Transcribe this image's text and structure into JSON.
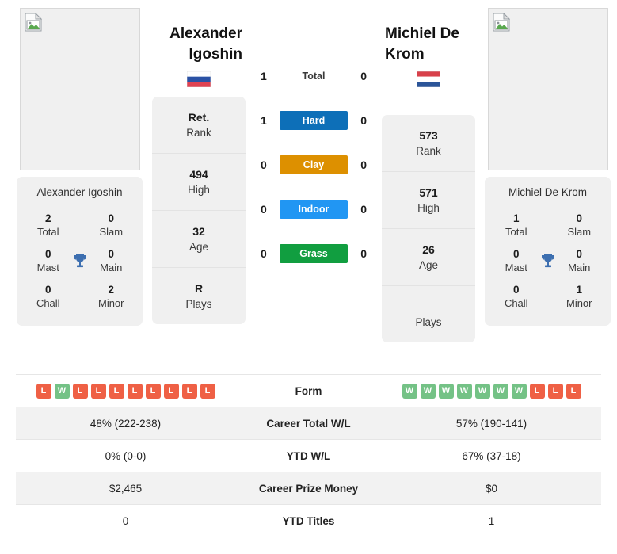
{
  "players": {
    "left": {
      "name": "Alexander Igoshin",
      "name_line1": "Alexander",
      "name_line2": "Igoshin",
      "flag": "russia-flag",
      "photo": "broken-image-icon",
      "info": [
        {
          "value": "Ret.",
          "label": "Rank"
        },
        {
          "value": "494",
          "label": "High"
        },
        {
          "value": "32",
          "label": "Age"
        },
        {
          "value": "R",
          "label": "Plays"
        }
      ],
      "titles": [
        {
          "value": "2",
          "label": "Total"
        },
        {
          "value": "0",
          "label": "Slam"
        },
        {
          "value": "0",
          "label": "Mast"
        },
        {
          "value": "0",
          "label": "Main"
        },
        {
          "value": "0",
          "label": "Chall"
        },
        {
          "value": "2",
          "label": "Minor"
        }
      ],
      "form": [
        "L",
        "W",
        "L",
        "L",
        "L",
        "L",
        "L",
        "L",
        "L",
        "L"
      ]
    },
    "right": {
      "name": "Michiel De Krom",
      "name_line1": "Michiel De",
      "name_line2": "Krom",
      "flag": "netherlands-flag",
      "photo": "broken-image-icon",
      "info": [
        {
          "value": "573",
          "label": "Rank"
        },
        {
          "value": "571",
          "label": "High"
        },
        {
          "value": "26",
          "label": "Age"
        },
        {
          "value": "",
          "label": "Plays"
        }
      ],
      "titles": [
        {
          "value": "1",
          "label": "Total"
        },
        {
          "value": "0",
          "label": "Slam"
        },
        {
          "value": "0",
          "label": "Mast"
        },
        {
          "value": "0",
          "label": "Main"
        },
        {
          "value": "0",
          "label": "Chall"
        },
        {
          "value": "1",
          "label": "Minor"
        }
      ],
      "form": [
        "W",
        "W",
        "W",
        "W",
        "W",
        "W",
        "W",
        "L",
        "L",
        "L"
      ]
    }
  },
  "head_to_head": [
    {
      "surface": "Total",
      "left": "1",
      "right": "0",
      "color": "none",
      "style": "plain"
    },
    {
      "surface": "Hard",
      "left": "1",
      "right": "0",
      "color": "#0D6FB8",
      "style": "badge"
    },
    {
      "surface": "Clay",
      "left": "0",
      "right": "0",
      "color": "#DD9000",
      "style": "badge"
    },
    {
      "surface": "Indoor",
      "left": "0",
      "right": "0",
      "color": "#2196F3",
      "style": "badge"
    },
    {
      "surface": "Grass",
      "left": "0",
      "right": "0",
      "color": "#119E40",
      "style": "badge"
    }
  ],
  "comparison_rows": [
    {
      "label": "Form",
      "left": "",
      "right": "",
      "type": "form"
    },
    {
      "label": "Career Total W/L",
      "left": "48% (222-238)",
      "right": "57% (190-141)",
      "type": "text"
    },
    {
      "label": "YTD W/L",
      "left": "0% (0-0)",
      "right": "67% (37-18)",
      "type": "text"
    },
    {
      "label": "Career Prize Money",
      "left": "$2,465",
      "right": "$0",
      "type": "text"
    },
    {
      "label": "YTD Titles",
      "left": "0",
      "right": "1",
      "type": "text"
    }
  ],
  "colors": {
    "win_badge": "#74C286",
    "loss_badge": "#EF6045",
    "trophy": "#3D6FB0",
    "card_bg": "#F0F0F0",
    "alt_row_bg": "#F2F2F2"
  }
}
